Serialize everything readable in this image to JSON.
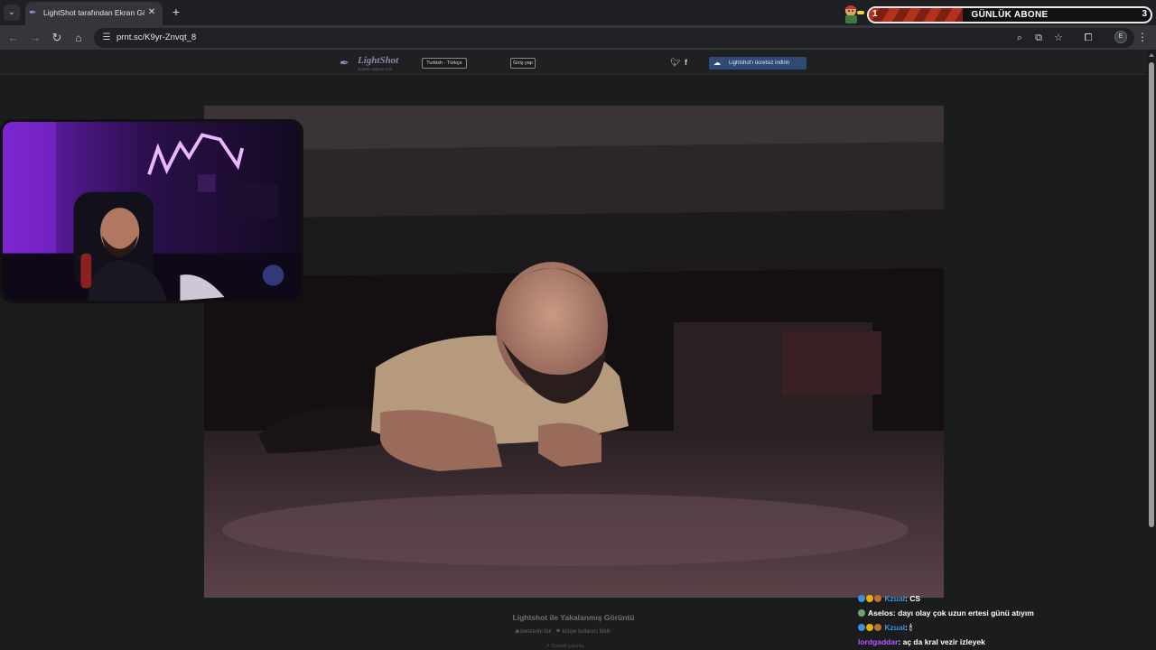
{
  "browser": {
    "tab_title": "LightShot tarafından Ekran Görüntüsü",
    "tab_close": "✕",
    "new_tab": "+",
    "url": "prnt.sc/K9yr-Znvqt_8",
    "profile_initial": "E"
  },
  "overlay": {
    "sub_goal": {
      "current": "1",
      "label": "GÜNLÜK ABONE",
      "target": "3",
      "progress_fraction": 0.333
    }
  },
  "lightshot": {
    "logo": "LightShot",
    "tagline": "screen capture tool",
    "language_button": "Turkish - Türkçe",
    "login_button": "Giriş yap",
    "download_button": "Lightshot'ı ücretsiz indirin",
    "footer_title": "Lightshot ile Yakalanmış Görüntü",
    "footer_links": [
      "benzerini bul",
      "köüye kullanıcı bildir"
    ],
    "footer_extra": "Görseli yayınla"
  },
  "chat": {
    "messages": [
      {
        "user": "Kzual",
        "text": "CS",
        "user_color": "#3d8fe6"
      },
      {
        "user": "Aselos",
        "text": "dayı olay çok uzun ertesi günü atıyım",
        "user_color": "#ffffff"
      },
      {
        "user": "Kzual",
        "text": "🕯",
        "user_color": "#3d8fe6"
      },
      {
        "user": "lordgaddar",
        "text": "aç da kral vezir izleyek",
        "user_color": "#b05cff"
      }
    ]
  },
  "colors": {
    "accent_purple": "#b05cff",
    "chat_blue": "#3d8fe6",
    "sub_bar_red": "#b3321f",
    "download_blue": "#2f4a75"
  }
}
